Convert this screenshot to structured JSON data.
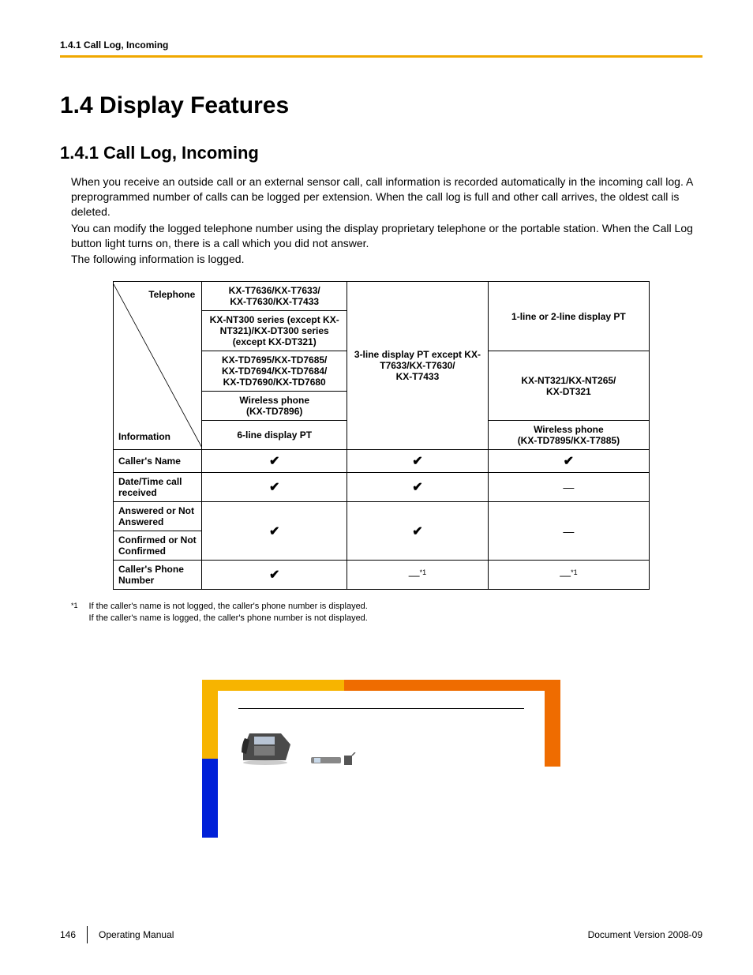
{
  "header": {
    "running": "1.4.1 Call Log, Incoming"
  },
  "titles": {
    "section": "1.4  Display Features",
    "subsection": "1.4.1  Call Log, Incoming"
  },
  "body": {
    "p1": "When you receive an outside call or an external sensor call, call information is recorded automatically in the incoming call log. A preprogrammed number of calls can be logged per extension. When the call log is full and other call arrives, the oldest call is deleted.",
    "p2": "You can modify the logged telephone number using the display proprietary telephone or the portable station. When the Call Log button light turns on, there is a call which you did not answer.",
    "p3": "The following information is logged."
  },
  "table": {
    "diag_top": "Telephone",
    "diag_bottom": "Information",
    "col2_r1": "KX-T7636/KX-T7633/\nKX-T7630/KX-T7433",
    "col2_r2": "KX-NT300 series (except KX-NT321)/KX-DT300 series (except KX-DT321)",
    "col2_r3": "KX-TD7695/KX-TD7685/\nKX-TD7694/KX-TD7684/\nKX-TD7690/KX-TD7680",
    "col2_r4": "Wireless phone\n(KX-TD7896)",
    "col2_r5": "6-line display PT",
    "col3": "3-line display PT except KX-T7633/KX-T7630/\nKX-T7433",
    "col4_r1": "1-line or 2-line display PT",
    "col4_r2": "KX-NT321/KX-NT265/\nKX-DT321",
    "col4_r3": "Wireless phone\n(KX-TD7895/KX-T7885)",
    "rows": [
      {
        "label": "Caller's Name",
        "c2": "check",
        "c3": "check",
        "c4": "check"
      },
      {
        "label": "Date/Time call received",
        "c2": "check",
        "c3": "check",
        "c4": "dash"
      },
      {
        "label": "Answered or Not Answered",
        "c2": "check_span",
        "c3": "check_span",
        "c4": "dash_span"
      },
      {
        "label": "Confirmed or Not Confirmed"
      },
      {
        "label": "Caller's Phone Number",
        "c2": "check",
        "c3": "dashstar",
        "c4": "dashstar"
      }
    ]
  },
  "footnote": {
    "marker": "*1",
    "line1": "If the caller's name is not logged, the caller's phone number is displayed.",
    "line2": "If the caller's name is logged, the caller's phone number is not displayed."
  },
  "footer": {
    "page": "146",
    "manual": "Operating Manual",
    "version": "Document Version  2008-09"
  },
  "glyphs": {
    "check": "✔",
    "dash": "—",
    "dashstar_dash": "—",
    "dashstar_sup": "*1"
  }
}
